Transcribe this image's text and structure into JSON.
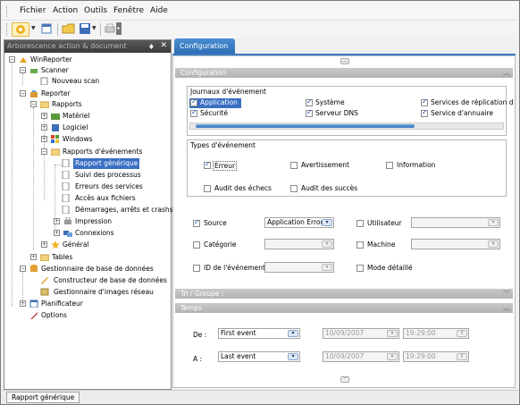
{
  "menubar": {
    "items": [
      {
        "label": "Fichier"
      },
      {
        "label": "Action"
      },
      {
        "label": "Outils"
      },
      {
        "label": "Fenêtre"
      },
      {
        "label": "Aide"
      }
    ]
  },
  "toolbar": {
    "icons": [
      "run-icon",
      "dropdown-arrow-icon",
      "new-window-icon",
      "open-folder-icon",
      "save-icon",
      "dropdown-arrow-icon",
      "print-icon",
      "more-icon"
    ]
  },
  "left_panel": {
    "title": "Arborescence action & document",
    "pin_glyph": "♦",
    "close_glyph": "✕",
    "tree": [
      {
        "label": "WinReporter"
      },
      {
        "label": "Scanner"
      },
      {
        "label": "Nouveau scan"
      },
      {
        "label": "Reporter"
      },
      {
        "label": "Rapports"
      },
      {
        "label": "Matériel"
      },
      {
        "label": "Logiciel"
      },
      {
        "label": "Windows"
      },
      {
        "label": "Rapports d'événements"
      },
      {
        "label": "Rapport générique"
      },
      {
        "label": "Suivi des processus"
      },
      {
        "label": "Erreurs des services"
      },
      {
        "label": "Accès aux fichiers"
      },
      {
        "label": "Démarrages, arrêts et crashs"
      },
      {
        "label": "Impression"
      },
      {
        "label": "Connexions"
      },
      {
        "label": "Général"
      },
      {
        "label": "Tables"
      },
      {
        "label": "Gestionnaire de base de données"
      },
      {
        "label": "Constructeur de base de données"
      },
      {
        "label": "Gestionnaire d'images réseau"
      },
      {
        "label": "Planificateur"
      },
      {
        "label": "Options"
      }
    ]
  },
  "right_panel": {
    "tab_label": "Configuration",
    "config_header": "Configuration",
    "journaux": {
      "title": "Journaux d'événement",
      "items": [
        {
          "label": "Application",
          "checked": true,
          "selected": true
        },
        {
          "label": "Système",
          "checked": true
        },
        {
          "label": "Services de réplication d",
          "checked": true
        },
        {
          "label": "Sécurité",
          "checked": true
        },
        {
          "label": "Serveur DNS",
          "checked": true
        },
        {
          "label": "Service d'annuaire",
          "checked": true
        }
      ]
    },
    "types": {
      "title": "Types d'événement",
      "items": [
        {
          "label": "Erreur",
          "checked": true
        },
        {
          "label": "Avertissement",
          "checked": false
        },
        {
          "label": "Information",
          "checked": false
        },
        {
          "label": "Audit des échecs",
          "checked": false
        },
        {
          "label": "Audit des succès",
          "checked": false
        }
      ]
    },
    "filters": {
      "source": {
        "label": "Source",
        "checked": true,
        "value": "Application Error"
      },
      "utilisateur": {
        "label": "Utilisateur",
        "checked": false,
        "value": ""
      },
      "categorie": {
        "label": "Catégorie",
        "checked": false,
        "value": ""
      },
      "machine": {
        "label": "Machine",
        "checked": false,
        "value": ""
      },
      "id_evenement": {
        "label": "ID de l'événement",
        "checked": false,
        "value": ""
      },
      "mode_detaille": {
        "label": "Mode détaillé",
        "checked": false
      }
    },
    "tri_header": "Tri / Groupe :",
    "temps_header": "Temps",
    "temps": {
      "de_label": "De :",
      "de_value": "First event",
      "de_date": "10/09/2007",
      "de_time": "19:29:00",
      "a_label": "A :",
      "a_value": "Last event",
      "a_date": "10/09/2007",
      "a_time": "19:29:00"
    }
  },
  "statusbar": {
    "tab_label": "Rapport générique"
  },
  "colors": {
    "accent": "#3a6fc4",
    "tab": "#2d6db5",
    "section": "#b8b8b8"
  }
}
